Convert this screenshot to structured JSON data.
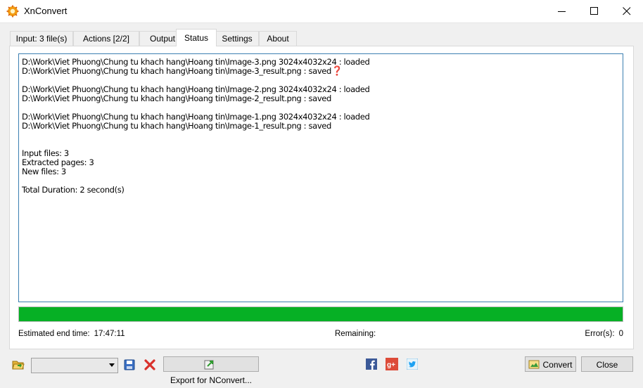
{
  "window": {
    "title": "XnConvert"
  },
  "tabs": [
    {
      "label": "Input: 3 file(s)"
    },
    {
      "label": "Actions [2/2]"
    },
    {
      "label": "Output"
    },
    {
      "label": "Status"
    },
    {
      "label": "Settings"
    },
    {
      "label": "About"
    }
  ],
  "active_tab": "Status",
  "log": {
    "lines": [
      "D:\\Work\\Viet Phuong\\Chung tu khach hang\\Hoang tin\\Image-3.png 3024x4032x24 : loaded",
      "D:\\Work\\Viet Phuong\\Chung tu khach hang\\Hoang tin\\Image-3_result.png : saved",
      "",
      "D:\\Work\\Viet Phuong\\Chung tu khach hang\\Hoang tin\\Image-2.png 3024x4032x24 : loaded",
      "D:\\Work\\Viet Phuong\\Chung tu khach hang\\Hoang tin\\Image-2_result.png : saved",
      "",
      "D:\\Work\\Viet Phuong\\Chung tu khach hang\\Hoang tin\\Image-1.png 3024x4032x24 : loaded",
      "D:\\Work\\Viet Phuong\\Chung tu khach hang\\Hoang tin\\Image-1_result.png : saved",
      "",
      "",
      "Input files: 3",
      "Extracted pages: 3",
      "New files: 3",
      "",
      "Total Duration: 2 second(s)"
    ],
    "marker_icon": "question-mark-icon"
  },
  "progress": {
    "percent": 100,
    "color": "#06b025"
  },
  "status": {
    "estimated_label": "Estimated end time:",
    "estimated_value": "17:47:11",
    "remaining_label": "Remaining:",
    "errors_label": "Error(s):",
    "errors_value": "0"
  },
  "bottom": {
    "open_icon": "folder-open-icon",
    "preset_value": "",
    "save_icon": "save-icon",
    "delete_icon": "delete-icon",
    "export_label": "Export for NConvert...",
    "social": [
      "facebook-icon",
      "google-plus-icon",
      "twitter-icon"
    ],
    "convert_label": "Convert",
    "close_label": "Close"
  },
  "colors": {
    "accent_border": "#3c7fb1",
    "progress": "#06b025"
  }
}
